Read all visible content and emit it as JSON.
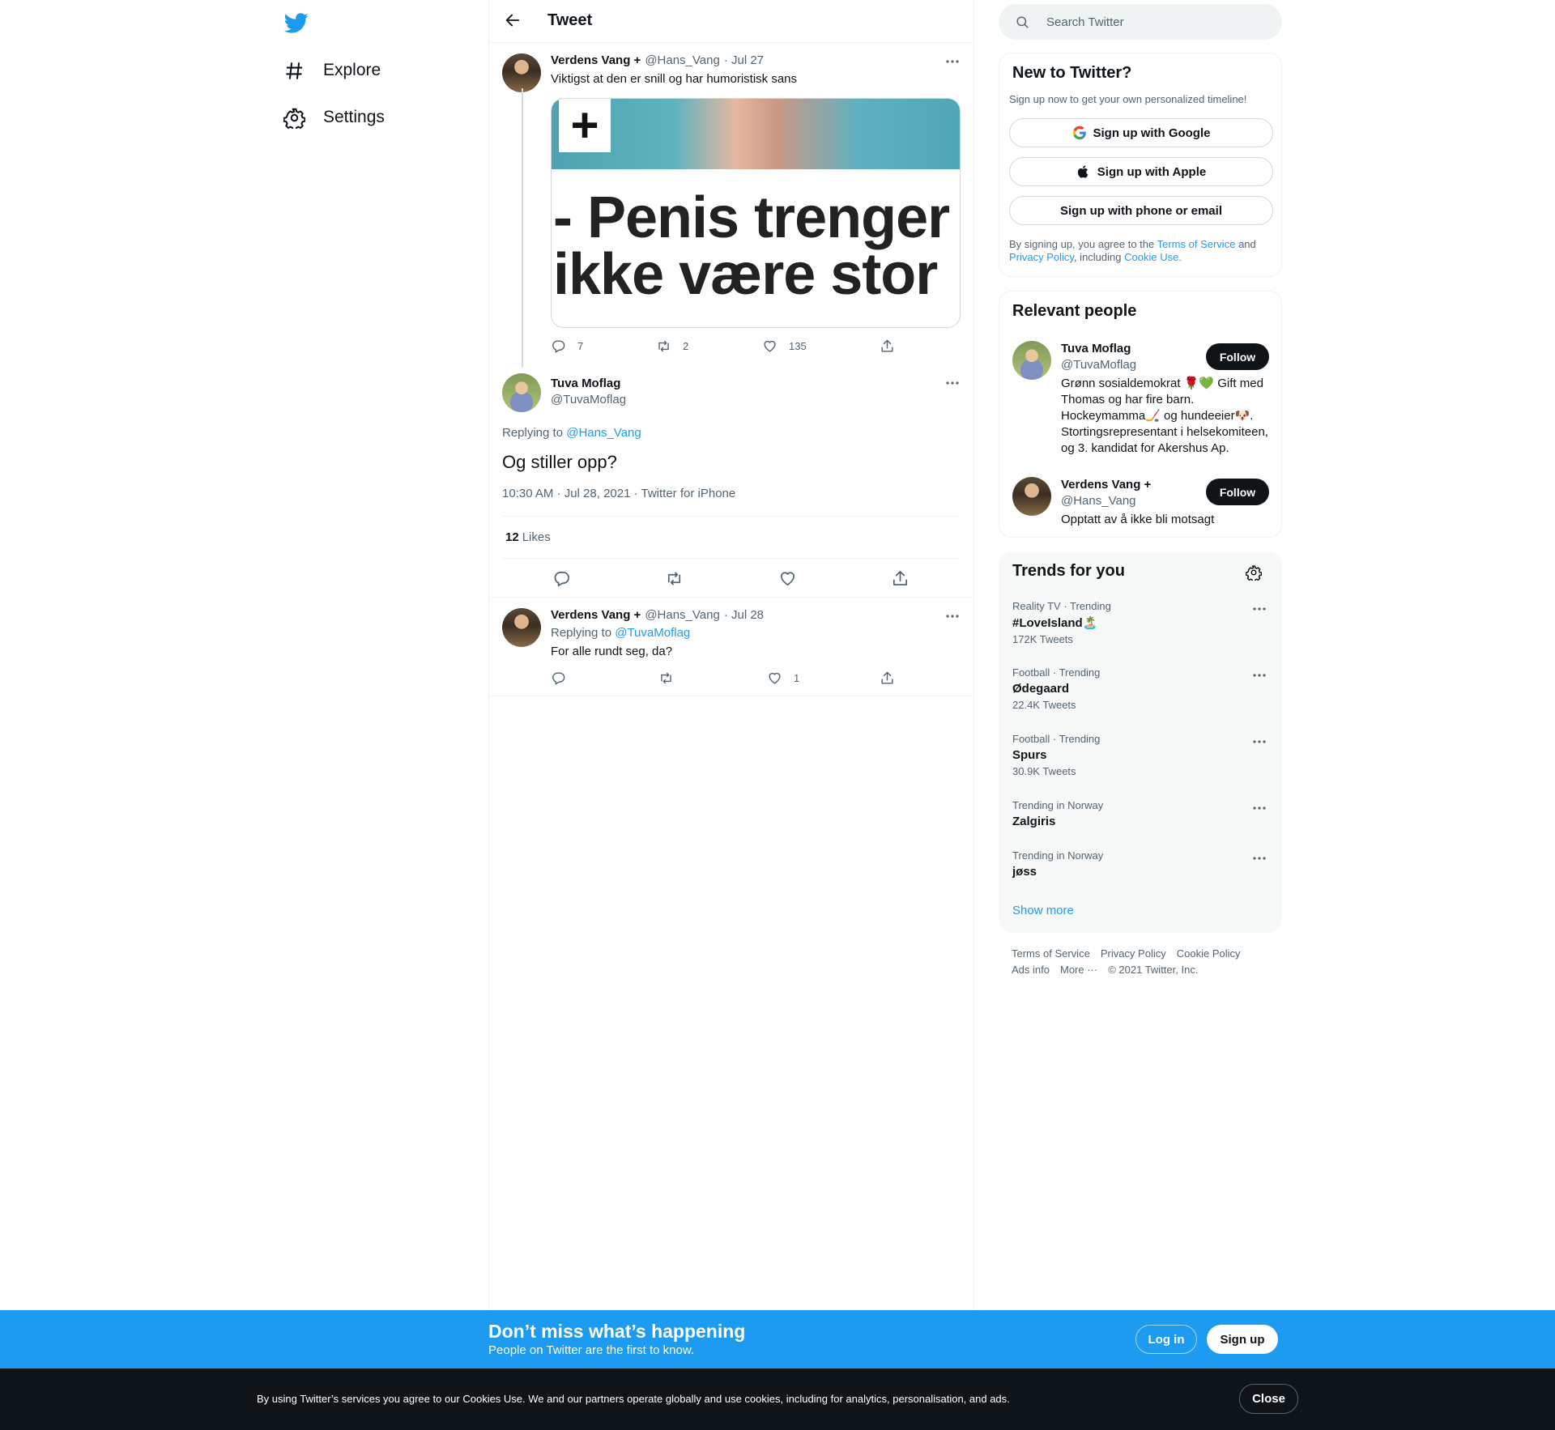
{
  "nav": {
    "explore": "Explore",
    "settings": "Settings"
  },
  "header": {
    "title": "Tweet"
  },
  "thread": {
    "parent": {
      "name": "Verdens Vang +",
      "handle": "@Hans_Vang",
      "date": "· Jul 27",
      "text": "Viktigst at den er snill og har humoristisk sans",
      "card_plus": "+",
      "card_headline_1": "- Penis trenger",
      "card_headline_2": "ikke være stor",
      "replies": "7",
      "retweets": "2",
      "likes": "135"
    },
    "main": {
      "name": "Tuva Moflag",
      "handle": "@TuvaMoflag",
      "replying_prefix": "Replying to",
      "replying_to": "@Hans_Vang",
      "text": "Og stiller opp?",
      "timestamp": "10:30 AM · Jul 28, 2021 · Twitter for iPhone",
      "likes_count": "12",
      "likes_label": "Likes"
    },
    "reply": {
      "name": "Verdens Vang +",
      "handle": "@Hans_Vang",
      "date": "· Jul 28",
      "replying_prefix": "Replying to",
      "replying_to": "@TuvaMoflag",
      "text": "For alle rundt seg, da?",
      "likes": "1"
    }
  },
  "search": {
    "placeholder": "Search Twitter"
  },
  "signup_box": {
    "title": "New to Twitter?",
    "subtitle": "Sign up now to get your own personalized timeline!",
    "google": "Sign up with Google",
    "apple": "Sign up with Apple",
    "phone": "Sign up with phone or email",
    "legal_1": "By signing up, you agree to the",
    "terms": "Terms of Service",
    "and": "and",
    "privacy": "Privacy Policy",
    "including": ", including",
    "cookie": "Cookie Use."
  },
  "relevant": {
    "title": "Relevant people",
    "people": [
      {
        "name": "Tuva Moflag",
        "handle": "@TuvaMoflag",
        "bio": "Grønn sosialdemokrat 🌹💚 Gift med Thomas og har fire barn. Hockeymamma🏒 og hundeeier🐶. Stortingsrepresentant i helsekomiteen, og 3. kandidat for Akershus Ap.",
        "follow": "Follow"
      },
      {
        "name": "Verdens Vang +",
        "handle": "@Hans_Vang",
        "bio": "Opptatt av å ikke bli motsagt",
        "follow": "Follow"
      }
    ]
  },
  "trends": {
    "title": "Trends for you",
    "items": [
      {
        "meta": "Reality TV · Trending",
        "name": "#LoveIsland🏝️",
        "count": "172K Tweets"
      },
      {
        "meta": "Football · Trending",
        "name": "Ødegaard",
        "count": "22.4K Tweets"
      },
      {
        "meta": "Football · Trending",
        "name": "Spurs",
        "count": "30.9K Tweets"
      },
      {
        "meta": "Trending in Norway",
        "name": "Zalgiris",
        "count": ""
      },
      {
        "meta": "Trending in Norway",
        "name": "jøss",
        "count": ""
      }
    ],
    "show_more": "Show more"
  },
  "footer": {
    "terms": "Terms of Service",
    "privacy": "Privacy Policy",
    "cookie": "Cookie Policy",
    "ads": "Ads info",
    "more": "More ···",
    "copyright": "© 2021 Twitter, Inc."
  },
  "banner": {
    "title": "Don’t miss what’s happening",
    "subtitle": "People on Twitter are the first to know.",
    "login": "Log in",
    "signup": "Sign up"
  },
  "cookies": {
    "text": "By using Twitter’s services you agree to our Cookies Use. We and our partners operate globally and use cookies, including for analytics, personalisation, and ads.",
    "close": "Close"
  },
  "colors": {
    "accent": "#1d9bf0",
    "text": "#0f1419",
    "muted": "#536471",
    "dark": "#0f1419"
  }
}
